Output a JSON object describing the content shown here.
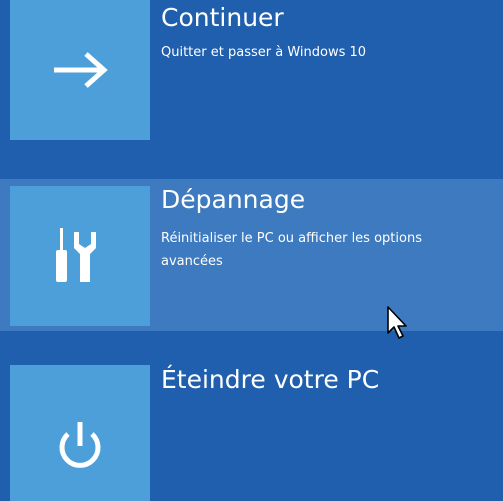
{
  "screen": {
    "background_color": "#1f5fad",
    "tile_color": "#4c9fd9",
    "hover_color": "#3d7abf"
  },
  "options": [
    {
      "title": "Continuer",
      "description": "Quitter et passer à Windows 10",
      "icon": "arrow-right-icon",
      "hovered": false
    },
    {
      "title": "Dépannage",
      "description": "Réinitialiser le PC ou afficher les options avancées",
      "icon": "tools-icon",
      "hovered": true
    },
    {
      "title": "Éteindre votre PC",
      "description": "",
      "icon": "power-icon",
      "hovered": false
    }
  ]
}
